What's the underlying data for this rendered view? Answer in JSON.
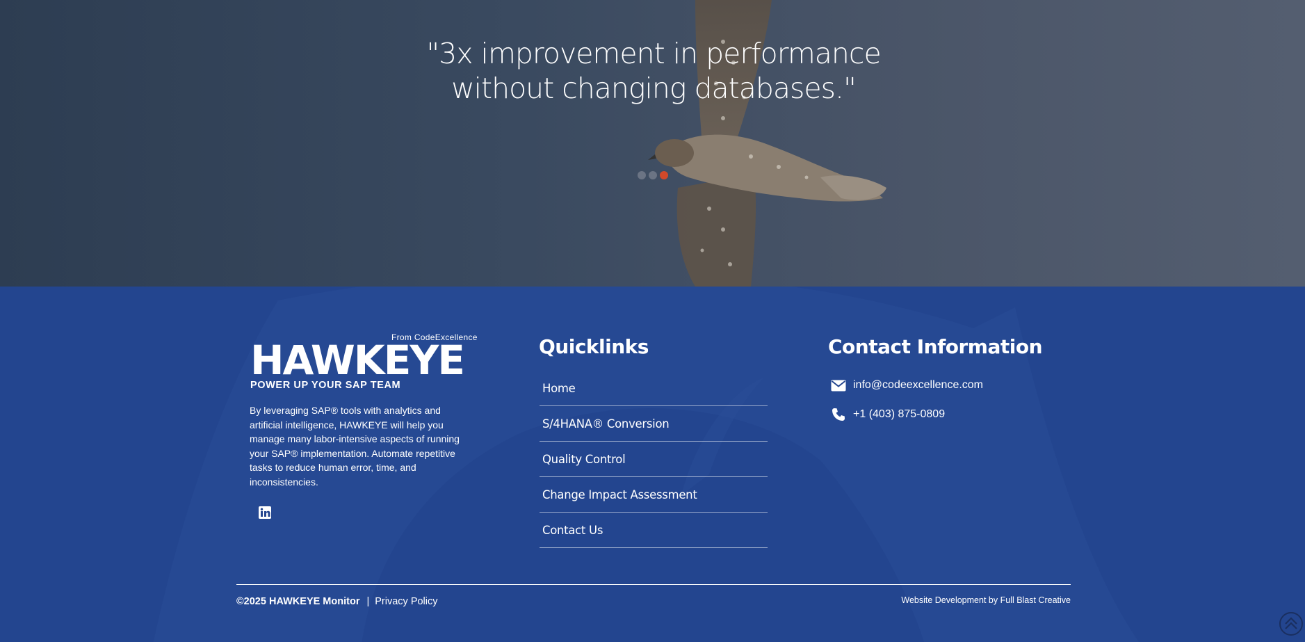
{
  "hero": {
    "quote": "\"3x improvement in performance without changing databases.\"",
    "slides": [
      {
        "label": "slide-1",
        "active": false
      },
      {
        "label": "slide-2",
        "active": false
      },
      {
        "label": "slide-3",
        "active": true
      }
    ]
  },
  "footer": {
    "logo": {
      "from": "From CodeExcellence",
      "wordmark": "HAWKEYE",
      "tagline": "POWER UP YOUR SAP TEAM"
    },
    "about": "By leveraging SAP® tools with analytics and artificial intelligence, HAWKEYE will help you manage many labor-intensive aspects of running your SAP® implementation.  Automate repetitive tasks to reduce human error, time, and inconsistencies.",
    "social": {
      "icon": "linkedin-icon"
    },
    "quicklinks": {
      "title": "Quicklinks",
      "items": [
        {
          "label": "Home"
        },
        {
          "label": "S/4HANA® Conversion"
        },
        {
          "label": "Quality Control"
        },
        {
          "label": "Change Impact Assessment"
        },
        {
          "label": "Contact Us"
        }
      ]
    },
    "contact": {
      "title": "Contact Information",
      "email": "info@codeexcellence.com",
      "phone": "+1 (403) 875-0809",
      "email_icon": "envelope-icon",
      "phone_icon": "phone-icon"
    },
    "bottom": {
      "copyright": "©2025 HAWKEYE Monitor",
      "separator": "|",
      "privacy": "Privacy Policy",
      "credit": "Website Development by Full Blast Creative"
    }
  },
  "colors": {
    "footer_bg": "#23458f",
    "accent_dot": "#d2492a",
    "hero_bg": "#3a4a60"
  }
}
